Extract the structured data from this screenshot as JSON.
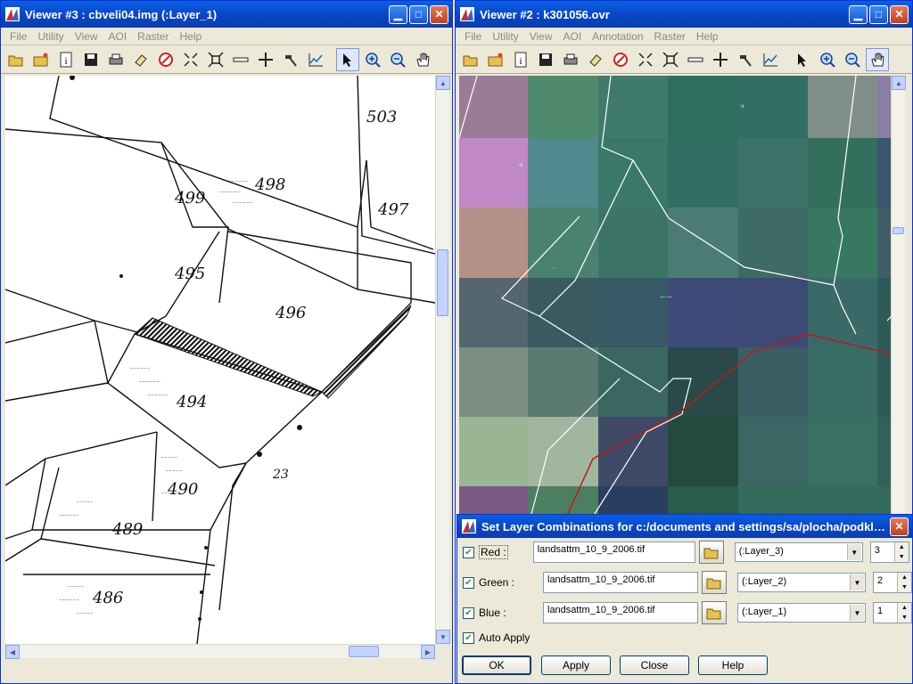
{
  "viewer3": {
    "title": "Viewer #3 : cbveli04.img (:Layer_1)",
    "menu": [
      "File",
      "Utility",
      "View",
      "AOI",
      "Raster",
      "Help"
    ],
    "map_labels": [
      {
        "text": "503"
      },
      {
        "text": "498"
      },
      {
        "text": "499"
      },
      {
        "text": "497"
      },
      {
        "text": "495"
      },
      {
        "text": "496"
      },
      {
        "text": "494"
      },
      {
        "text": "490"
      },
      {
        "text": "489"
      },
      {
        "text": "486"
      },
      {
        "text": "23"
      }
    ]
  },
  "viewer2": {
    "title": "Viewer #2 : k301056.ovr",
    "menu": [
      "File",
      "Utility",
      "View",
      "AOI",
      "Annotation",
      "Raster",
      "Help"
    ]
  },
  "dialog": {
    "title": "Set Layer Combinations for c:/documents and settings/sa/plocha/podkla...",
    "rows": [
      {
        "label": "Red :",
        "file": "landsattm_10_9_2006.tif",
        "layer": "(:Layer_3)",
        "band": "3",
        "checked": true
      },
      {
        "label": "Green :",
        "file": "landsattm_10_9_2006.tif",
        "layer": "(:Layer_2)",
        "band": "2",
        "checked": true
      },
      {
        "label": "Blue :",
        "file": "landsattm_10_9_2006.tif",
        "layer": "(:Layer_1)",
        "band": "1",
        "checked": true
      }
    ],
    "auto_apply_label": "Auto Apply",
    "auto_apply_checked": true,
    "buttons": {
      "ok": "OK",
      "apply": "Apply",
      "close": "Close",
      "help": "Help"
    }
  },
  "colors": {
    "title_bar": "#0a5fe4",
    "close_button": "#c1401e",
    "boundary_line": "#c01818"
  }
}
